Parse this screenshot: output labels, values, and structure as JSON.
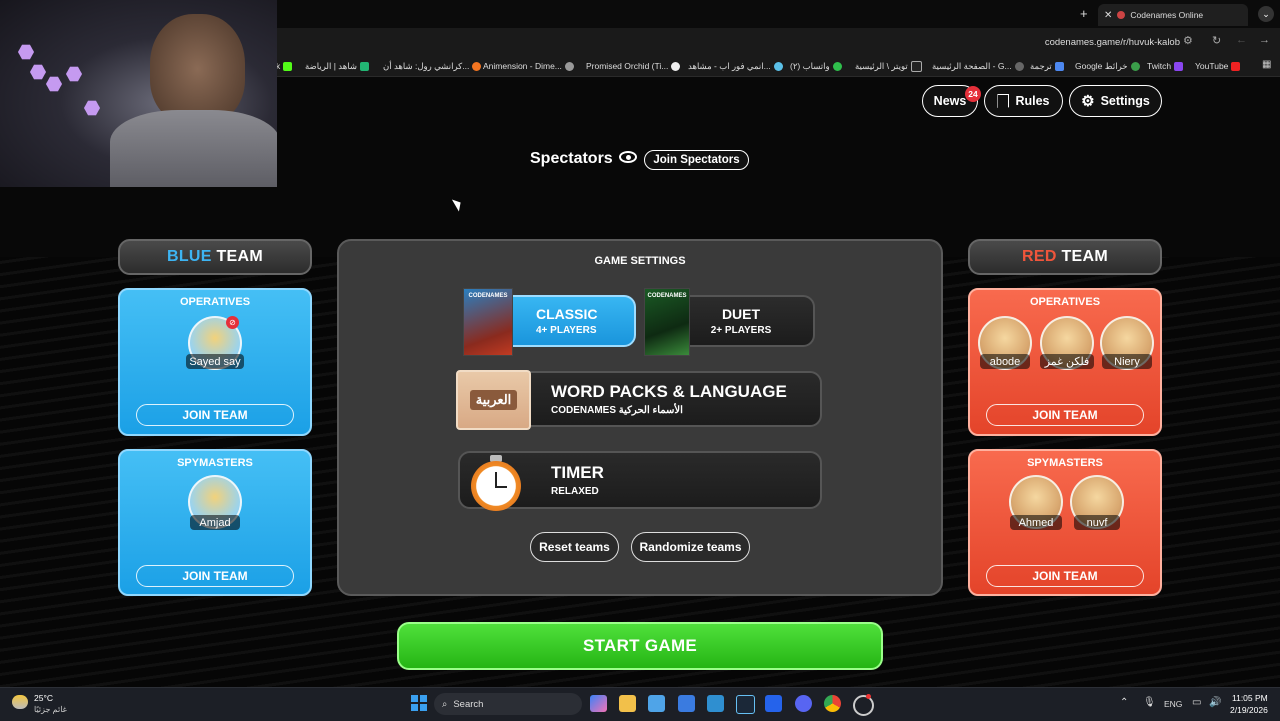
{
  "browser": {
    "tab_title": "Codenames Online",
    "url": "codenames.game/r/huvuk-kalob",
    "bookmarks": [
      "YouTube",
      "Twitch",
      "Google خرائط",
      "ترجمة",
      "الصفحة الرئيسية - G...",
      "تويتر \\ الرئيسية",
      "واتساب (٢)",
      "انمي فور اب - مشاهد...",
      "Promised Orchid (Ti...",
      "Animension - Dime...",
      "كرانشي رول: شاهد أن...",
      "شاهد | الرياضة",
      "k"
    ]
  },
  "header": {
    "news_label": "News",
    "news_badge": "24",
    "rules_label": "Rules",
    "settings_label": "Settings",
    "spectators_label": "Spectators",
    "join_spectators_label": "Join Spectators"
  },
  "blue_team": {
    "title_word": "BLUE",
    "title_suffix": " TEAM",
    "operatives_label": "OPERATIVES",
    "operatives": [
      "Sayed say"
    ],
    "spymasters_label": "SPYMASTERS",
    "spymasters": [
      "Amjad"
    ],
    "join_label": "JOIN TEAM"
  },
  "red_team": {
    "title_word": "RED",
    "title_suffix": " TEAM",
    "operatives_label": "OPERATIVES",
    "operatives": [
      "abode",
      "فلكن غمز",
      "Niery"
    ],
    "spymasters_label": "SPYMASTERS",
    "spymasters": [
      "Ahmed",
      "nuvf"
    ],
    "join_label": "JOIN TEAM"
  },
  "game_settings": {
    "title": "GAME SETTINGS",
    "classic_label": "CLASSIC",
    "classic_sub": "4+ PLAYERS",
    "duet_label": "DUET",
    "duet_sub": "2+ PLAYERS",
    "word_packs_label": "WORD PACKS & LANGUAGE",
    "word_packs_sub": "CODENAMES الأسماء الحركية",
    "language_card": "العربية",
    "timer_label": "TIMER",
    "timer_sub": "RELAXED",
    "reset_label": "Reset teams",
    "randomize_label": "Randomize teams",
    "box_title": "CODENAMES"
  },
  "start_label": "START GAME",
  "taskbar": {
    "weather_temp": "25°C",
    "weather_desc": "غائم جزئيًا",
    "search_label": "Search",
    "lang": "ENG",
    "time": "11:05 PM",
    "date": "2/19/2026"
  },
  "colors": {
    "blue": "#3db4f2",
    "red": "#f0553b",
    "green": "#32c61f"
  }
}
